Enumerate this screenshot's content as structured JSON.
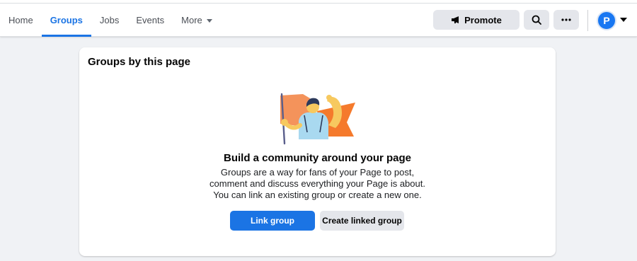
{
  "nav": {
    "items": [
      {
        "label": "Home",
        "active": false
      },
      {
        "label": "Groups",
        "active": true
      },
      {
        "label": "Jobs",
        "active": false
      },
      {
        "label": "Events",
        "active": false
      },
      {
        "label": "More",
        "active": false
      }
    ]
  },
  "header": {
    "promote_label": "Promote",
    "avatar_letter": "P",
    "accent_color": "#1b74e4"
  },
  "card": {
    "title": "Groups by this page",
    "headline": "Build a community around your page",
    "description_lines": [
      "Groups are a way for fans of your Page to post,",
      "comment and discuss everything your Page is about.",
      "You can link an existing group or create a new one."
    ],
    "link_group_label": "Link group",
    "create_linked_group_label": "Create linked group"
  },
  "icons": {
    "promote": "megaphone-icon",
    "search": "search-icon",
    "more": "ellipsis-icon",
    "avatar_menu": "chevron-down-icon"
  }
}
